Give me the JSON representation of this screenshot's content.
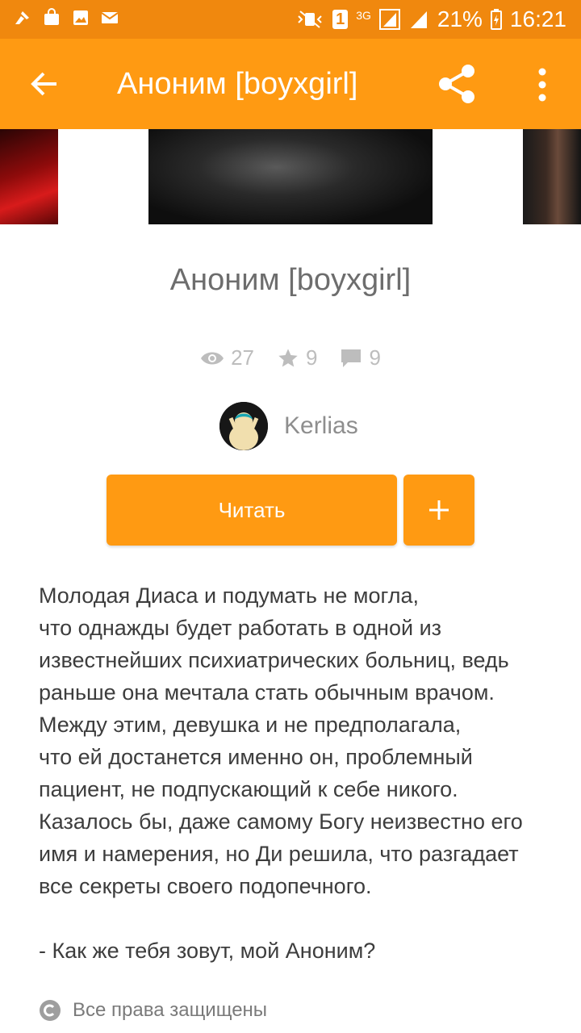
{
  "status_bar": {
    "battery": "21%",
    "time": "16:21",
    "network": "3G",
    "sim_slot": "1",
    "left_icons": [
      "cleaner-icon",
      "shopping-bag-icon",
      "image-icon",
      "mail-icon"
    ]
  },
  "app_bar": {
    "title": "Аноним [boyxgirl]",
    "back_icon": "arrow-back-icon",
    "share_icon": "share-icon",
    "more_icon": "more-vert-icon"
  },
  "story": {
    "title": "Аноним [boyxgirl]",
    "stats": {
      "views": "27",
      "votes": "9",
      "comments": "9"
    },
    "author": "Kerlias",
    "read_label": "Читать",
    "add_label": "+",
    "description": [
      "Молодая Диаса и подумать не могла,",
      "что однажды будет работать в одной из",
      "известнейших психиатрических больниц, ведь",
      "раньше она мечтала стать обычным врачом.",
      "Между этим, девушка и не предполагала,",
      "что ей достанется именно он, проблемный",
      "пациент, не подпускающий к себе никого.",
      "Казалось бы, даже самому Богу неизвестно его",
      "имя и намерения, но Ди решила, что разгадает",
      "все секреты своего подопечного."
    ],
    "quote": "- Как же тебя зовут, мой Аноним?",
    "rights": "Все права защищены"
  },
  "colors": {
    "accent": "#ff9a12",
    "status_bar": "#f0880e",
    "stat_gray": "#bdbdbd",
    "text": "#3d3d3d"
  }
}
